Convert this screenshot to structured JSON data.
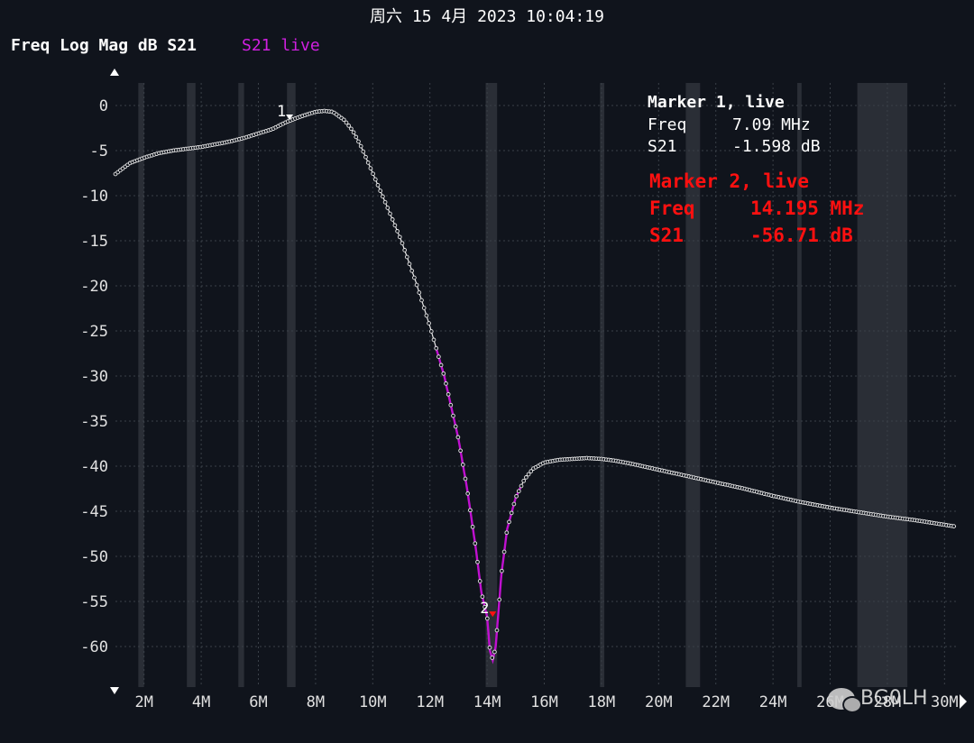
{
  "header": {
    "timestamp": "周六 15 4月 2023 10:04:19",
    "trace_title": "Freq Log Mag dB S21",
    "trace_live": "S21 live"
  },
  "colors": {
    "background": "#10141c",
    "grid": "#3a4048",
    "trace": "#e8e8e8",
    "trace_highlight": "#c010d0",
    "marker2": "#ff1010",
    "shade": "#2a2e36"
  },
  "chart_data": {
    "type": "line",
    "xlabel": "",
    "ylabel": "",
    "xlim": [
      1.0,
      30.4
    ],
    "ylim": [
      -64.5,
      2.5
    ],
    "x_ticks": [
      {
        "value": 2,
        "label": "2M"
      },
      {
        "value": 4,
        "label": "4M"
      },
      {
        "value": 6,
        "label": "6M"
      },
      {
        "value": 8,
        "label": "8M"
      },
      {
        "value": 10,
        "label": "10M"
      },
      {
        "value": 12,
        "label": "12M"
      },
      {
        "value": 14,
        "label": "14M"
      },
      {
        "value": 16,
        "label": "16M"
      },
      {
        "value": 18,
        "label": "18M"
      },
      {
        "value": 20,
        "label": "20M"
      },
      {
        "value": 22,
        "label": "22M"
      },
      {
        "value": 24,
        "label": "24M"
      },
      {
        "value": 26,
        "label": "26M"
      },
      {
        "value": 28,
        "label": "28M"
      },
      {
        "value": 30,
        "label": "30M"
      }
    ],
    "y_ticks": [
      {
        "value": 0,
        "label": "0"
      },
      {
        "value": -5,
        "label": "-5"
      },
      {
        "value": -10,
        "label": "-10"
      },
      {
        "value": -15,
        "label": "-15"
      },
      {
        "value": -20,
        "label": "-20"
      },
      {
        "value": -25,
        "label": "-25"
      },
      {
        "value": -30,
        "label": "-30"
      },
      {
        "value": -35,
        "label": "-35"
      },
      {
        "value": -40,
        "label": "-40"
      },
      {
        "value": -45,
        "label": "-45"
      },
      {
        "value": -50,
        "label": "-50"
      },
      {
        "value": -55,
        "label": "-55"
      },
      {
        "value": -60,
        "label": "-60"
      }
    ],
    "grid": true,
    "band_shades": [
      [
        1.8,
        2.0
      ],
      [
        3.5,
        3.8
      ],
      [
        5.3,
        5.5
      ],
      [
        7.0,
        7.3
      ],
      [
        13.95,
        14.35
      ],
      [
        17.95,
        18.1
      ],
      [
        20.95,
        21.45
      ],
      [
        24.85,
        25.0
      ],
      [
        26.95,
        28.7
      ]
    ],
    "series": [
      {
        "name": "S21",
        "x": [
          1.0,
          1.5,
          2.0,
          2.5,
          3.0,
          3.5,
          4.0,
          4.5,
          5.0,
          5.5,
          6.0,
          6.5,
          7.0,
          7.5,
          8.0,
          8.3,
          8.6,
          9.0,
          9.3,
          9.6,
          10.0,
          10.5,
          11.0,
          11.5,
          12.0,
          12.5,
          13.0,
          13.3,
          13.6,
          13.8,
          14.0,
          14.1,
          14.2,
          14.3,
          14.4,
          14.5,
          14.7,
          15.0,
          15.3,
          15.6,
          16.0,
          16.5,
          17.0,
          17.5,
          18.0,
          18.5,
          19.0,
          20.0,
          21.0,
          22.0,
          23.0,
          24.0,
          25.0,
          26.0,
          27.0,
          28.0,
          29.0,
          30.0,
          30.4
        ],
        "y": [
          -7.6,
          -6.4,
          -5.8,
          -5.3,
          -5.0,
          -4.8,
          -4.6,
          -4.3,
          -4.0,
          -3.6,
          -3.1,
          -2.6,
          -1.8,
          -1.2,
          -0.7,
          -0.6,
          -0.7,
          -1.6,
          -2.8,
          -4.6,
          -7.5,
          -11.2,
          -15.0,
          -19.5,
          -24.5,
          -30.0,
          -37.0,
          -42.5,
          -49.0,
          -54.0,
          -56.7,
          -60.5,
          -61.5,
          -60.0,
          -56.0,
          -52.0,
          -47.0,
          -43.5,
          -41.5,
          -40.3,
          -39.6,
          -39.3,
          -39.2,
          -39.1,
          -39.2,
          -39.4,
          -39.7,
          -40.4,
          -41.1,
          -41.8,
          -42.5,
          -43.3,
          -44.0,
          -44.6,
          -45.1,
          -45.6,
          -46.0,
          -46.5,
          -46.7
        ]
      }
    ],
    "highlight_range": [
      12.2,
      15.2
    ],
    "markers": [
      {
        "label": "1",
        "x": 7.09,
        "y": -1.598
      },
      {
        "label": "2",
        "x": 14.195,
        "y": -56.71
      }
    ]
  },
  "marker_box": {
    "m1_title": "Marker 1, live",
    "m1_freq_label": "Freq",
    "m1_freq_value": "7.09 MHz",
    "m1_s21_label": "S21",
    "m1_s21_value": "-1.598 dB",
    "m2_title": "Marker 2, live",
    "m2_freq_label": "Freq",
    "m2_freq_value": "14.195 MHz",
    "m2_s21_label": "S21",
    "m2_s21_value": "-56.71 dB"
  },
  "watermark": {
    "text": "BG0LH"
  }
}
